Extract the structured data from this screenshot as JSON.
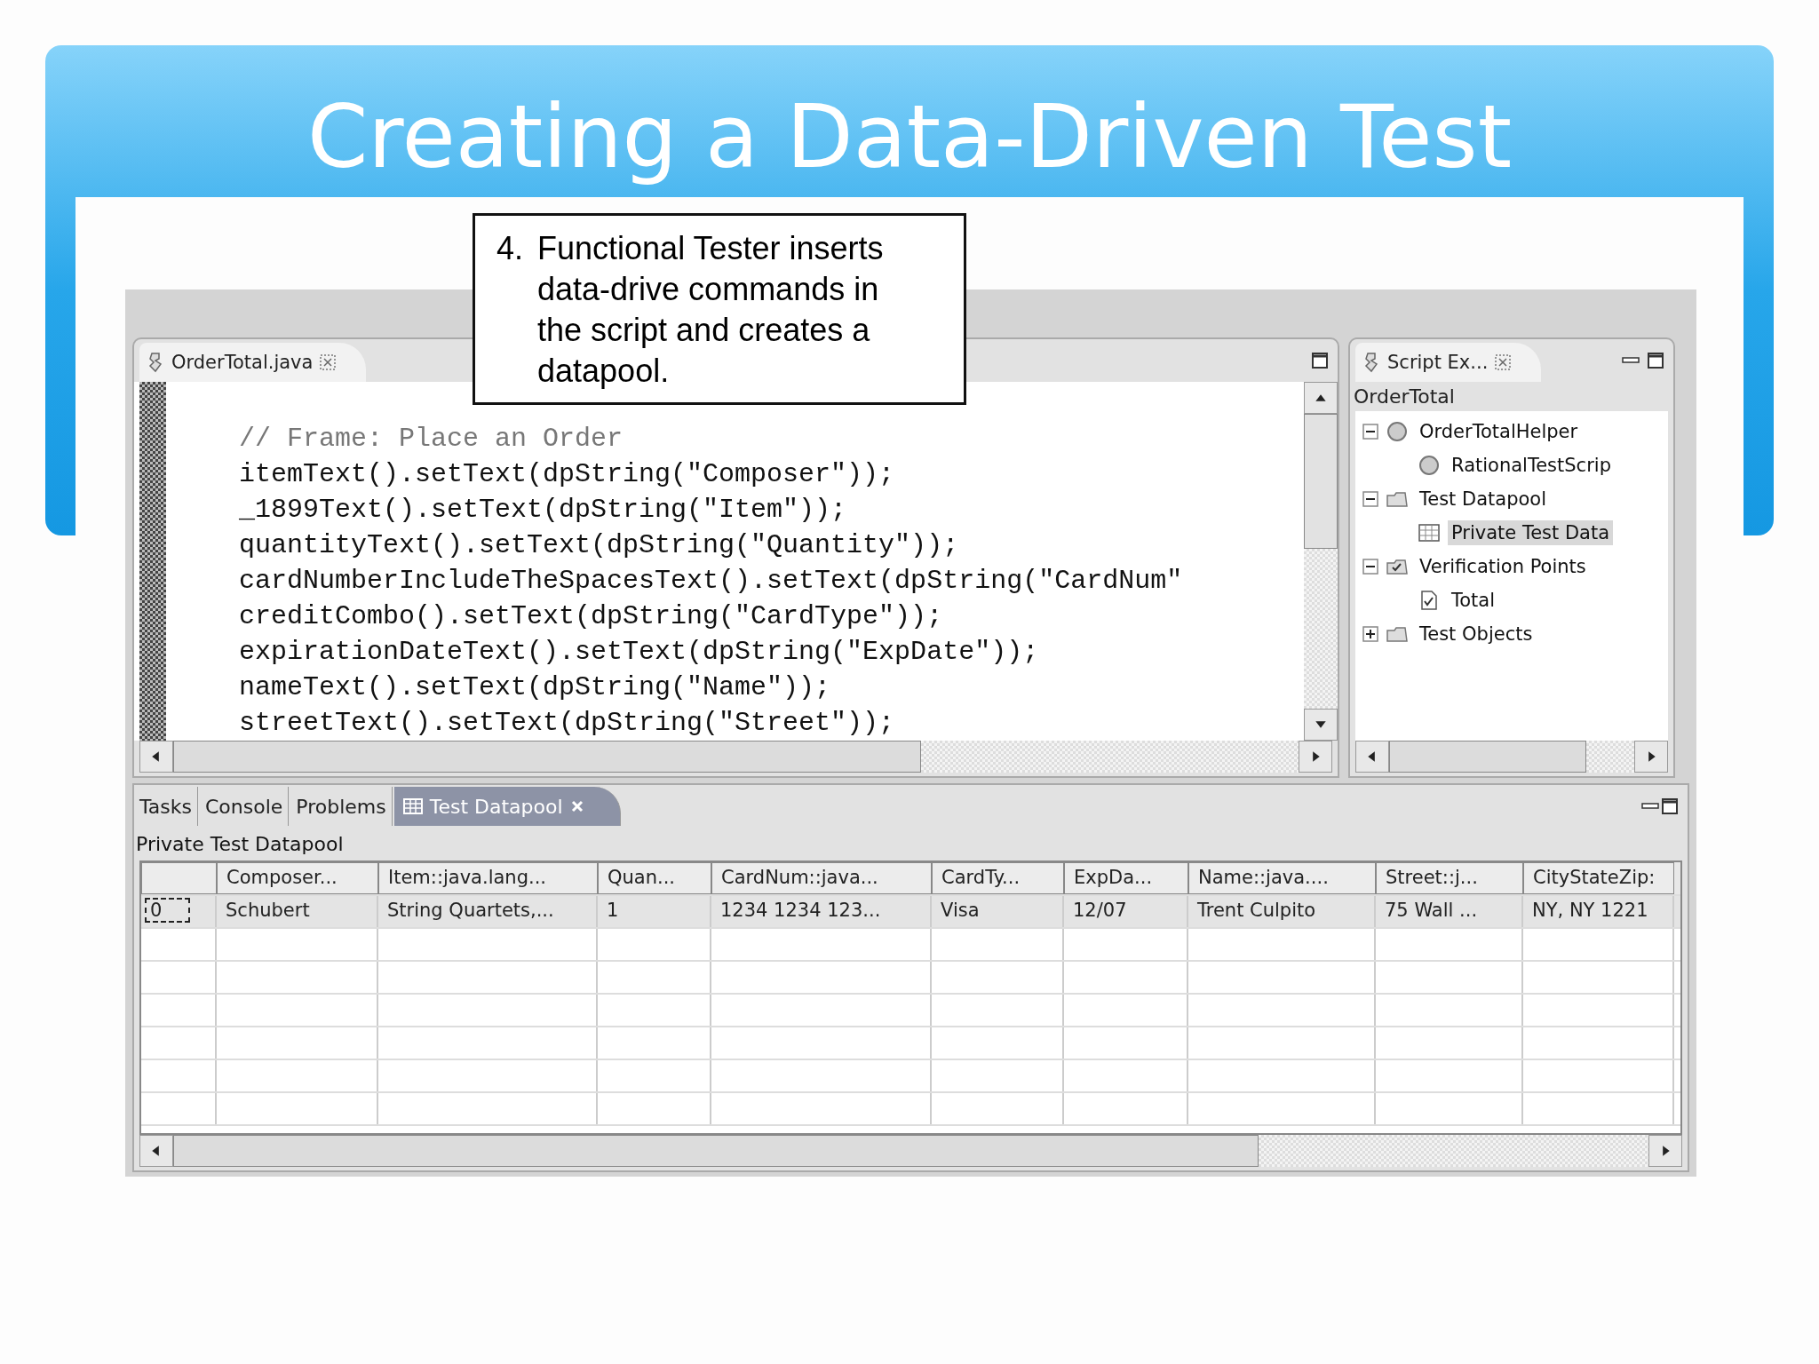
{
  "slide": {
    "title": "Creating a Data-Driven Test"
  },
  "callout": {
    "number": "4.",
    "text": "Functional Tester inserts data-drive commands in the script and creates a datapool."
  },
  "editor": {
    "tab": "OrderTotal.java",
    "code_lines": [
      {
        "kind": "comment",
        "text": "// Frame: Place an Order"
      },
      {
        "kind": "code",
        "text": "itemText().setText(dpString(\"Composer\"));"
      },
      {
        "kind": "code",
        "text": "_1899Text().setText(dpString(\"Item\"));"
      },
      {
        "kind": "code",
        "text": "quantityText().setText(dpString(\"Quantity\"));"
      },
      {
        "kind": "code",
        "text": "cardNumberIncludeTheSpacesText().setText(dpString(\"CardNum\""
      },
      {
        "kind": "code",
        "text": "creditCombo().setText(dpString(\"CardType\"));"
      },
      {
        "kind": "code",
        "text": "expirationDateText().setText(dpString(\"ExpDate\"));"
      },
      {
        "kind": "code",
        "text": "nameText().setText(dpString(\"Name\"));"
      },
      {
        "kind": "code",
        "text": "streetText().setText(dpString(\"Street\"));"
      }
    ]
  },
  "explorer": {
    "tab": "Script Ex...",
    "root": "OrderTotal",
    "tree": [
      {
        "label": "OrderTotalHelper",
        "kind": "class",
        "expanded": true,
        "selected": false,
        "children": [
          {
            "label": "RationalTestScrip",
            "kind": "class",
            "selected": false
          }
        ]
      },
      {
        "label": "Test Datapool",
        "kind": "datapool-folder",
        "expanded": true,
        "selected": false,
        "children": [
          {
            "label": "Private Test Data",
            "kind": "datapool",
            "selected": true
          }
        ]
      },
      {
        "label": "Verification Points",
        "kind": "vp-folder",
        "expanded": true,
        "selected": false,
        "children": [
          {
            "label": "Total",
            "kind": "vp",
            "selected": false
          }
        ]
      },
      {
        "label": "Test Objects",
        "kind": "objects-folder",
        "expanded": false,
        "selected": false
      }
    ]
  },
  "bottom": {
    "tabs": [
      {
        "label": "Tasks",
        "selected": false
      },
      {
        "label": "Console",
        "selected": false
      },
      {
        "label": "Problems",
        "selected": false
      },
      {
        "label": "Test Datapool",
        "selected": true
      }
    ],
    "title": "Private Test Datapool",
    "table": {
      "columns": [
        "Composer...",
        "Item::java.lang...",
        "Quan...",
        "CardNum::java...",
        "CardTy...",
        "ExpDa...",
        "Name::java....",
        "Street::j...",
        "CityStateZip:"
      ],
      "rows": [
        {
          "index": "0",
          "selected": true,
          "cells": [
            "Schubert",
            "String Quartets,...",
            "1",
            "1234 1234 123...",
            "Visa",
            "12/07",
            "Trent Culpito",
            "75 Wall ...",
            "NY, NY 1221"
          ]
        }
      ]
    }
  }
}
